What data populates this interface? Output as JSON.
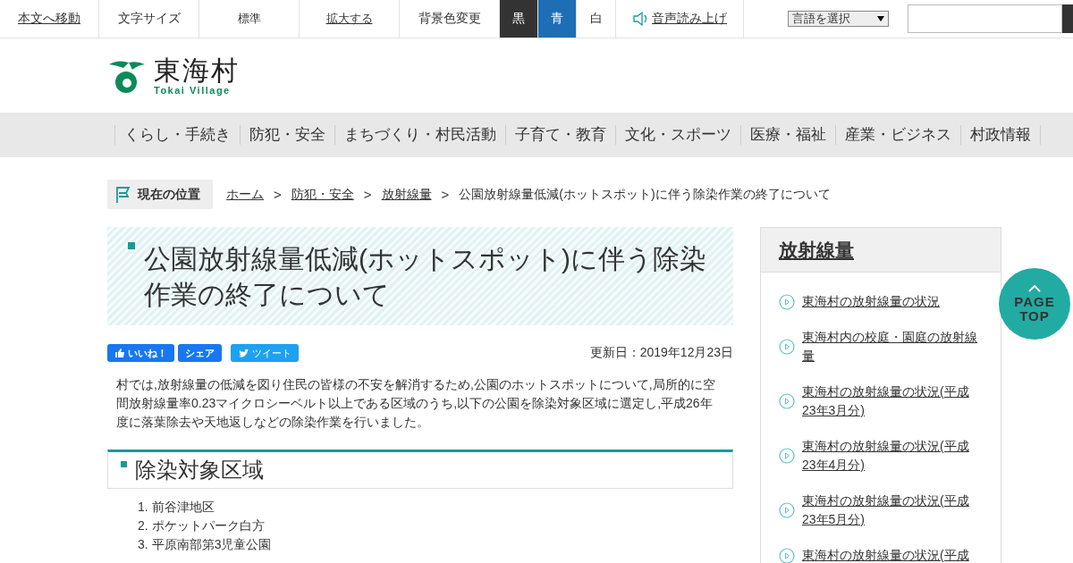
{
  "top_bar": {
    "skip_link": "本文へ移動",
    "font_size_label": "文字サイズ",
    "font_size_buttons": [
      {
        "label": "標準"
      },
      {
        "label": "拡大する"
      }
    ],
    "bg_label": "背景色変更",
    "bg_colors": [
      {
        "label": "黒",
        "color": "#333333"
      },
      {
        "label": "青",
        "color": "#1e6eb5"
      },
      {
        "label": "白",
        "color": "#ffffff"
      }
    ],
    "read_aloud": "音声読み上げ",
    "language_select": {
      "value": "言語を選択"
    }
  },
  "logo": {
    "title": "東海村",
    "subtitle": "Tokai Village"
  },
  "nav": [
    "くらし・手続き",
    "防犯・安全",
    "まちづくり・村民活動",
    "子育て・教育",
    "文化・スポーツ",
    "医療・福祉",
    "産業・ビジネス",
    "村政情報"
  ],
  "breadcrumb": {
    "label": "現在の位置",
    "separator": ">",
    "items": [
      {
        "label": "ホーム",
        "link": true
      },
      {
        "label": "防犯・安全",
        "link": true
      },
      {
        "label": "放射線量",
        "link": true
      },
      {
        "label": "公園放射線量低減(ホットスポット)に伴う除染作業の終了について",
        "link": false
      }
    ]
  },
  "article": {
    "title": "公園放射線量低減(ホットスポット)に伴う除染作業の終了について",
    "share_buttons": [
      {
        "kind": "like",
        "label": "いいね！"
      },
      {
        "kind": "share",
        "label": "シェア"
      },
      {
        "kind": "tweet",
        "label": "ツイート"
      }
    ],
    "updated": "更新日：2019年12月23日",
    "intro": "村では,放射線量の低減を図り住民の皆様の不安を解消するため,公園のホットスポットについて,局所的に空間放射線量率0.23マイクロシーベルト以上である区域のうち,以下の公園を除染対象区域に選定し,平成26年度に落葉除去や天地返しなどの除染作業を行いました。",
    "section_heading": "除染対象区域",
    "list": [
      {
        "number": "1.",
        "text": "前谷津地区"
      },
      {
        "number": "2.",
        "text": "ポケットパーク白方"
      },
      {
        "number": "3.",
        "text": "平原南部第3児童公園"
      }
    ]
  },
  "sidebar": {
    "heading": "放射線量",
    "links": [
      "東海村の放射線量の状況",
      "東海村内の校庭・園庭の放射線量",
      "東海村の放射線量の状況(平成23年3月分)",
      "東海村の放射線量の状況(平成23年4月分)",
      "東海村の放射線量の状況(平成23年5月分)",
      "東海村の放射線量の状況(平成"
    ]
  },
  "page_top": {
    "label": "PAGE TOP"
  }
}
